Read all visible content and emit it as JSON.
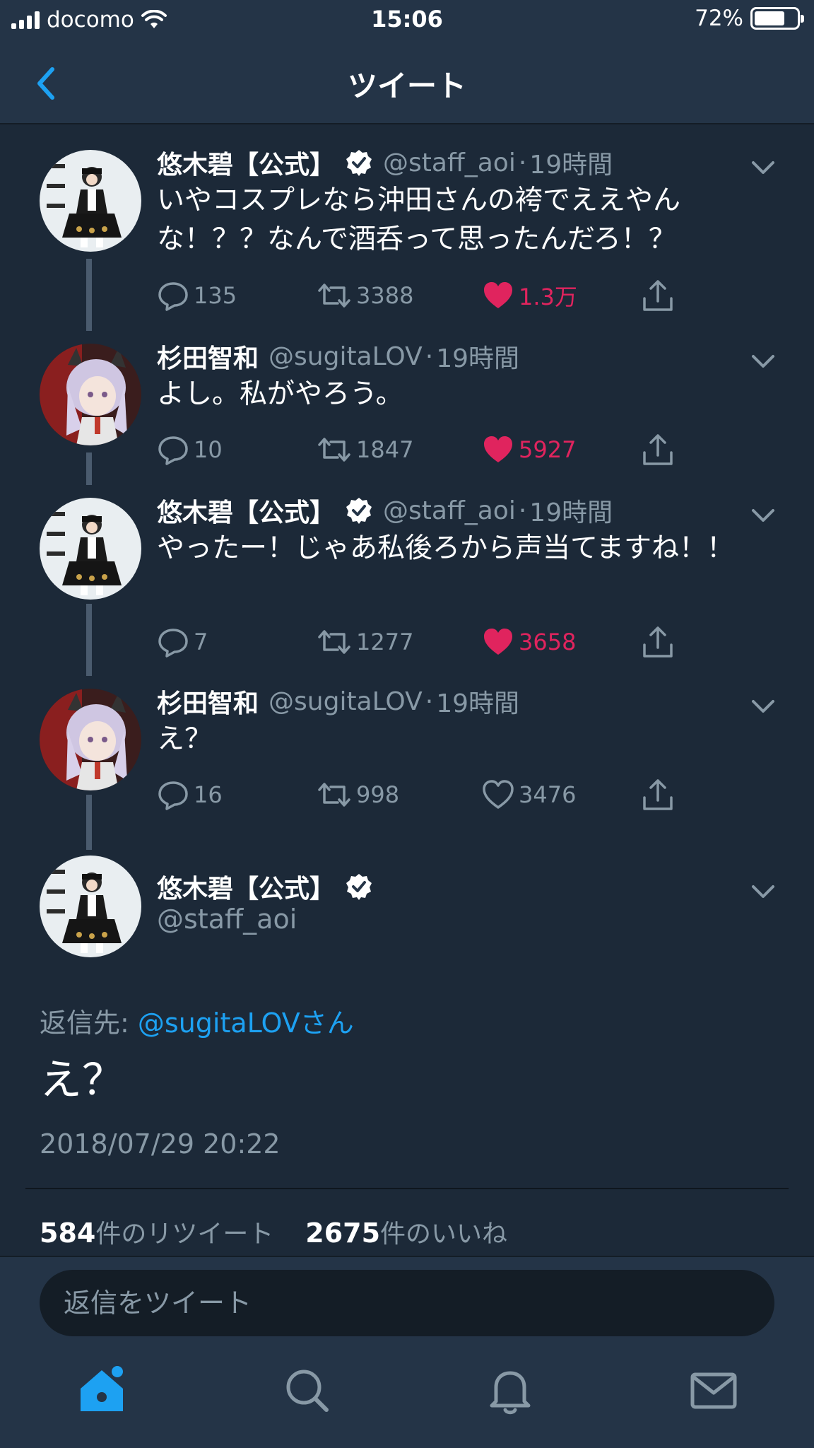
{
  "status_bar": {
    "carrier": "docomo",
    "time": "15:06",
    "battery": "72%",
    "battery_level": 0.72
  },
  "nav": {
    "title": "ツイート"
  },
  "colors": {
    "background": "#1c2938",
    "bar": "#243447",
    "accent": "#1da1f2",
    "like": "#e0245e",
    "muted": "#8899a6"
  },
  "thread": [
    {
      "name": "悠木碧【公式】",
      "verified": true,
      "handle": "@staff_aoi",
      "dot": "·",
      "ago": "19時間",
      "text": "いやコスプレなら沖田さんの袴でええやんな！？？なんで酒呑って思ったんだろ！？",
      "replies": "135",
      "retweets": "3388",
      "likes": "1.3万",
      "liked": true
    },
    {
      "name": "杉田智和",
      "verified": false,
      "handle": "@sugitaLOV",
      "dot": "·",
      "ago": "19時間",
      "text": "よし。私がやろう。",
      "replies": "10",
      "retweets": "1847",
      "likes": "5927",
      "liked": true
    },
    {
      "name": "悠木碧【公式】",
      "verified": true,
      "handle": "@staff_aoi",
      "dot": "·",
      "ago": "19時間",
      "text": "やったー！じゃあ私後ろから声当てますね！！",
      "replies": "7",
      "retweets": "1277",
      "likes": "3658",
      "liked": true
    },
    {
      "name": "杉田智和",
      "verified": false,
      "handle": "@sugitaLOV",
      "dot": "·",
      "ago": "19時間",
      "text": "え？",
      "replies": "16",
      "retweets": "998",
      "likes": "3476",
      "liked": false
    }
  ],
  "focused": {
    "name": "悠木碧【公式】",
    "verified": true,
    "handle": "@staff_aoi",
    "reply_label": "返信先: ",
    "reply_target": "@sugitaLOVさん",
    "text": "え？",
    "timestamp": "2018/07/29 20:22",
    "retweet_count": "584",
    "retweet_label": "件のリツイート",
    "like_count": "2675",
    "like_label": "件のいいね"
  },
  "reply_box": {
    "placeholder": "返信をツイート"
  },
  "tabs": [
    {
      "icon": "home-icon",
      "active": true
    },
    {
      "icon": "search-icon",
      "active": false
    },
    {
      "icon": "bell-icon",
      "active": false
    },
    {
      "icon": "mail-icon",
      "active": false
    }
  ]
}
